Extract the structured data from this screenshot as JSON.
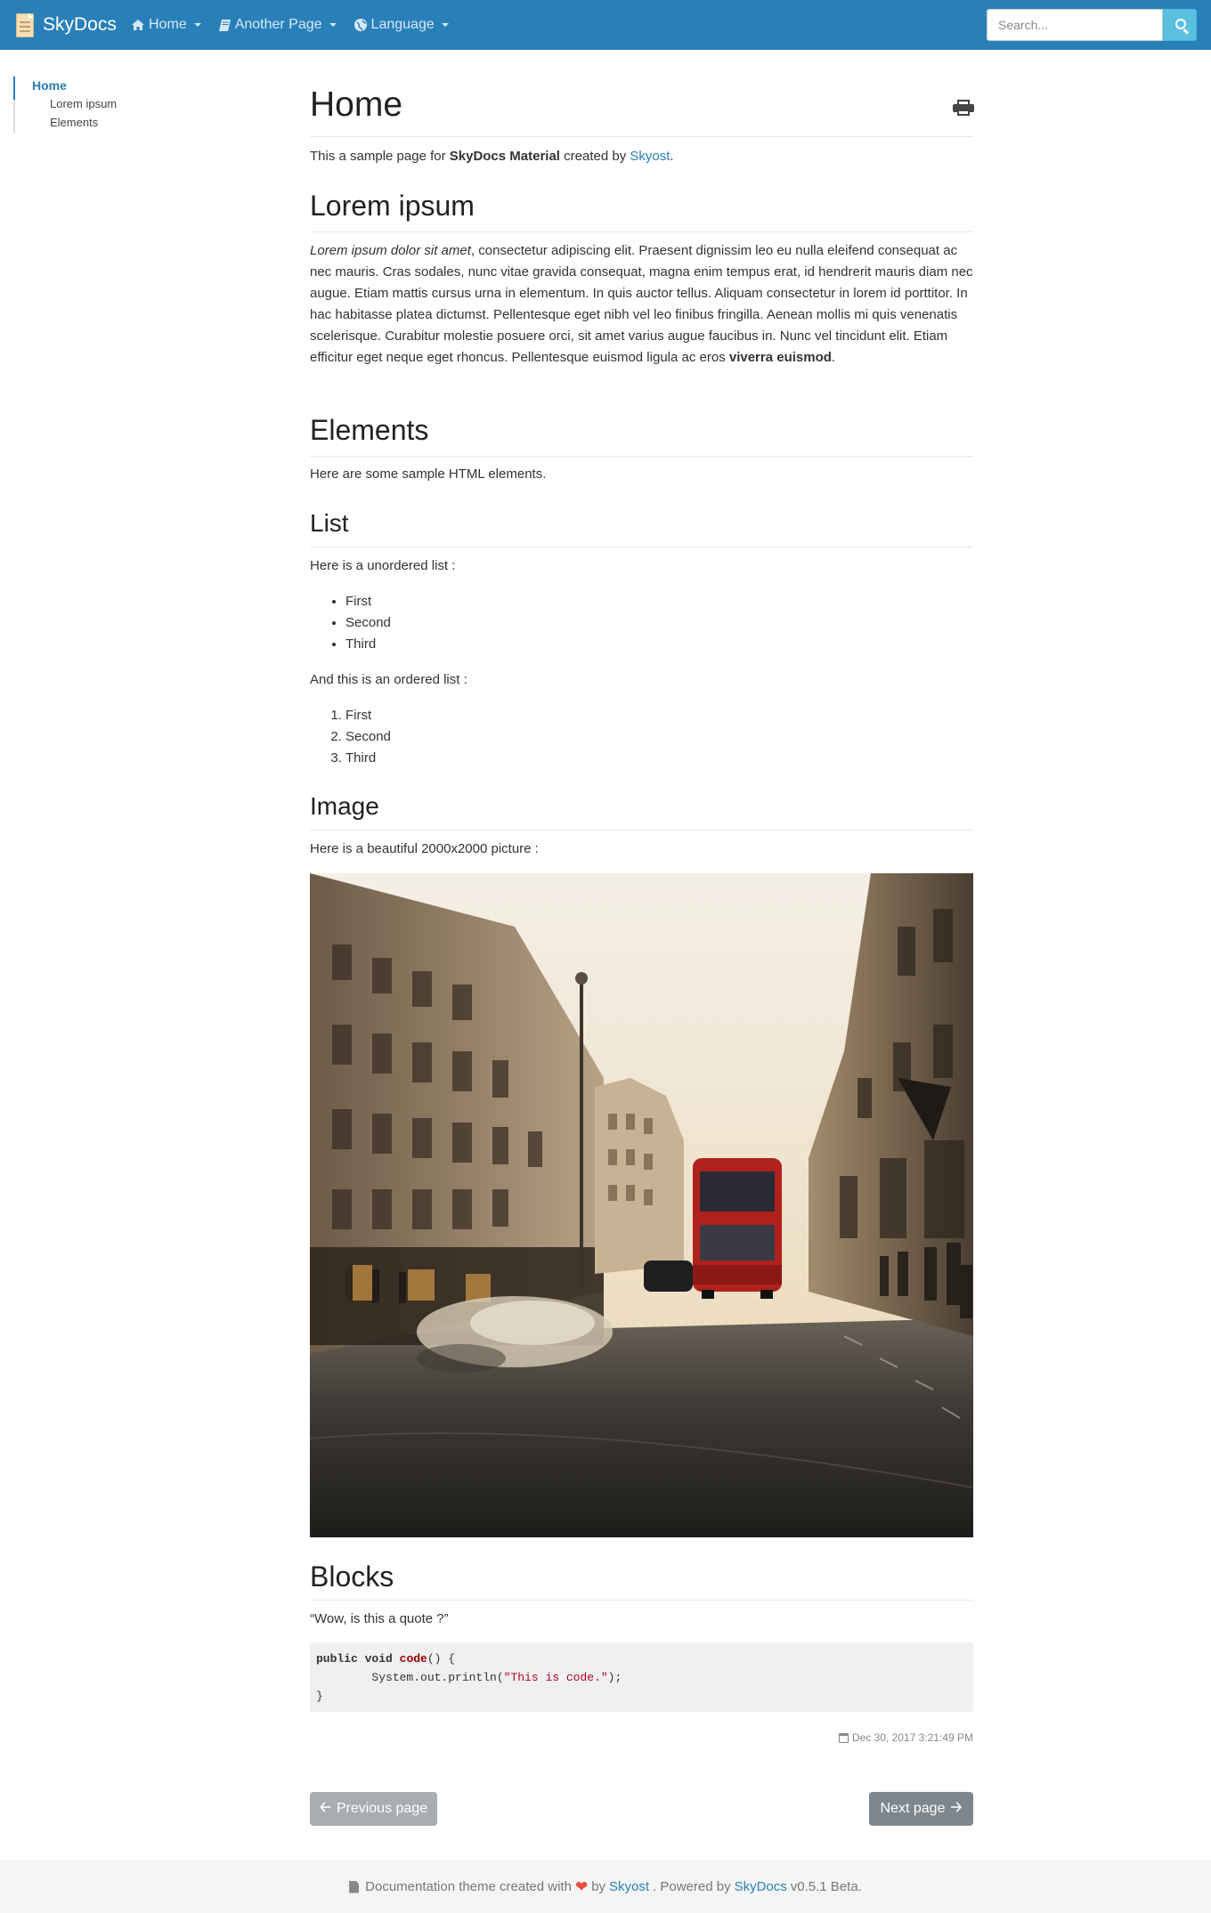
{
  "navbar": {
    "brand": "SkyDocs",
    "menu": [
      {
        "icon": "home-icon",
        "label": "Home"
      },
      {
        "icon": "book-icon",
        "label": "Another Page"
      },
      {
        "icon": "globe-icon",
        "label": "Language"
      }
    ],
    "search_placeholder": "Search..."
  },
  "toc": {
    "active": "Home",
    "items": [
      "Lorem ipsum",
      "Elements"
    ]
  },
  "content": {
    "title": "Home",
    "intro": {
      "pre": "This a sample page for ",
      "bold": "SkyDocs Material",
      "mid": " created by ",
      "link": "Skyost",
      "post": "."
    },
    "lorem_heading": "Lorem ipsum",
    "lorem": {
      "italic": "Lorem ipsum dolor sit amet",
      "text": ", consectetur adipiscing elit. Praesent dignissim leo eu nulla eleifend consequat ac nec mauris. Cras sodales, nunc vitae gravida consequat, magna enim tempus erat, id hendrerit mauris diam nec augue. Etiam mattis cursus urna in elementum. In quis auctor tellus. Aliquam consectetur in lorem id porttitor. In hac habitasse platea dictumst. Pellentesque eget nibh vel leo finibus fringilla. Aenean mollis mi quis venenatis scelerisque. Curabitur molestie posuere orci, sit amet varius augue faucibus in. Nunc vel tincidunt elit. Etiam efficitur eget neque eget rhoncus. Pellentesque euismod ligula ac eros ",
      "bold": "viverra euismod",
      "end": "."
    },
    "elements_heading": "Elements",
    "elements_text": "Here are some sample HTML elements.",
    "list_heading": "List",
    "ul_intro": "Here is a unordered list :",
    "ul_items": [
      "First",
      "Second",
      "Third"
    ],
    "ol_intro": "And this is an ordered list :",
    "ol_items": [
      "First",
      "Second",
      "Third"
    ],
    "image_heading": "Image",
    "image_text": "Here is a beautiful 2000x2000 picture :",
    "blocks_heading": "Blocks",
    "quote": "“Wow, is this a quote ?”",
    "code": {
      "kw1": "public",
      "kw2": "void",
      "fn": "code",
      "line1_end": "() {",
      "line2_pre": "        System.out.println(",
      "str": "\"This is code.\"",
      "line2_end": ");",
      "line3": "}"
    },
    "date": "Dec 30, 2017 3:21:49 PM"
  },
  "pager": {
    "prev": "Previous page",
    "next": "Next page"
  },
  "footer": {
    "pre": "Documentation theme created with",
    "by": "by",
    "author": "Skyost",
    "powered": ". Powered by",
    "product": "SkyDocs",
    "version": "v0.5.1 Beta."
  },
  "colors": {
    "navbar": "#2980b9",
    "link": "#2980b9",
    "search_button": "#5bc0de",
    "heart": "#e74c3c"
  }
}
